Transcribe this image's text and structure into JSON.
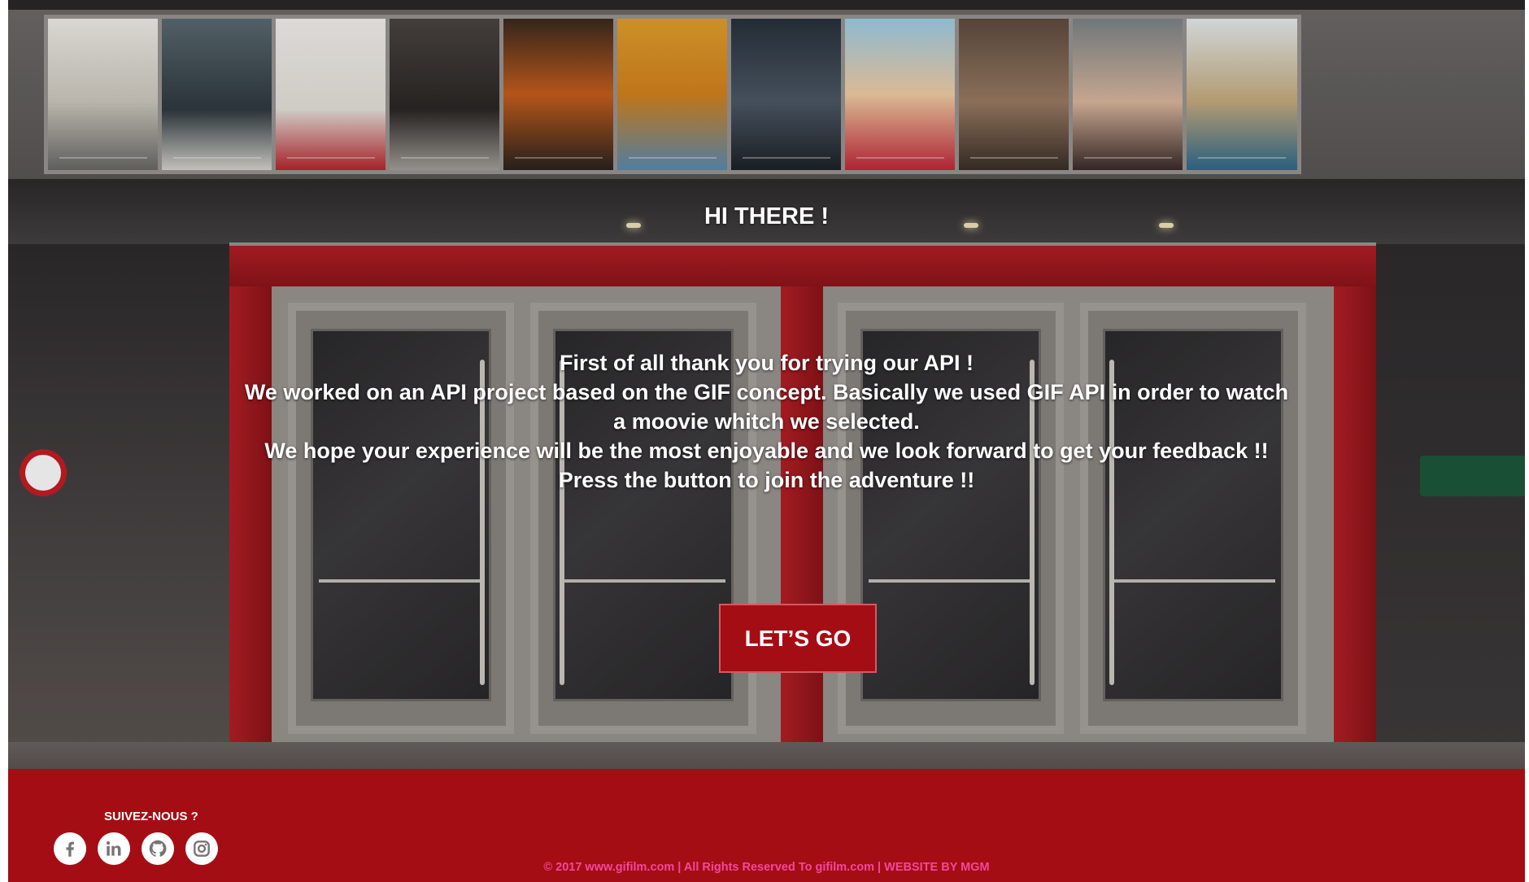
{
  "hero": {
    "greeting": "HI THERE !",
    "intro_lines": [
      "First of all thank you for trying our API !",
      "We worked on an API project based on the GIF concept. Basically we used GIF API in order to watch",
      "a moovie whitch we selected.",
      "We hope your experience will be the most enjoyable and we look forward to get your feedback !!",
      "Press the button to join the adventure !!"
    ],
    "cta_label": "LET’S GO"
  },
  "footer": {
    "follow_label": "SUIVEZ-NOUS ?",
    "socials": [
      {
        "name": "facebook-icon",
        "glyph": "f"
      },
      {
        "name": "linkedin-icon",
        "glyph": "in"
      },
      {
        "name": "github-icon",
        "glyph": ""
      },
      {
        "name": "instagram-icon",
        "glyph": ""
      }
    ],
    "copyright": "© 2017 www.gifilm.com | All Rights Reserved To gifilm.com | WEBSITE BY MGM"
  },
  "colors": {
    "brand_red": "#a50d14",
    "copyright_pink": "#f2489b",
    "text_white": "#ffffff"
  }
}
